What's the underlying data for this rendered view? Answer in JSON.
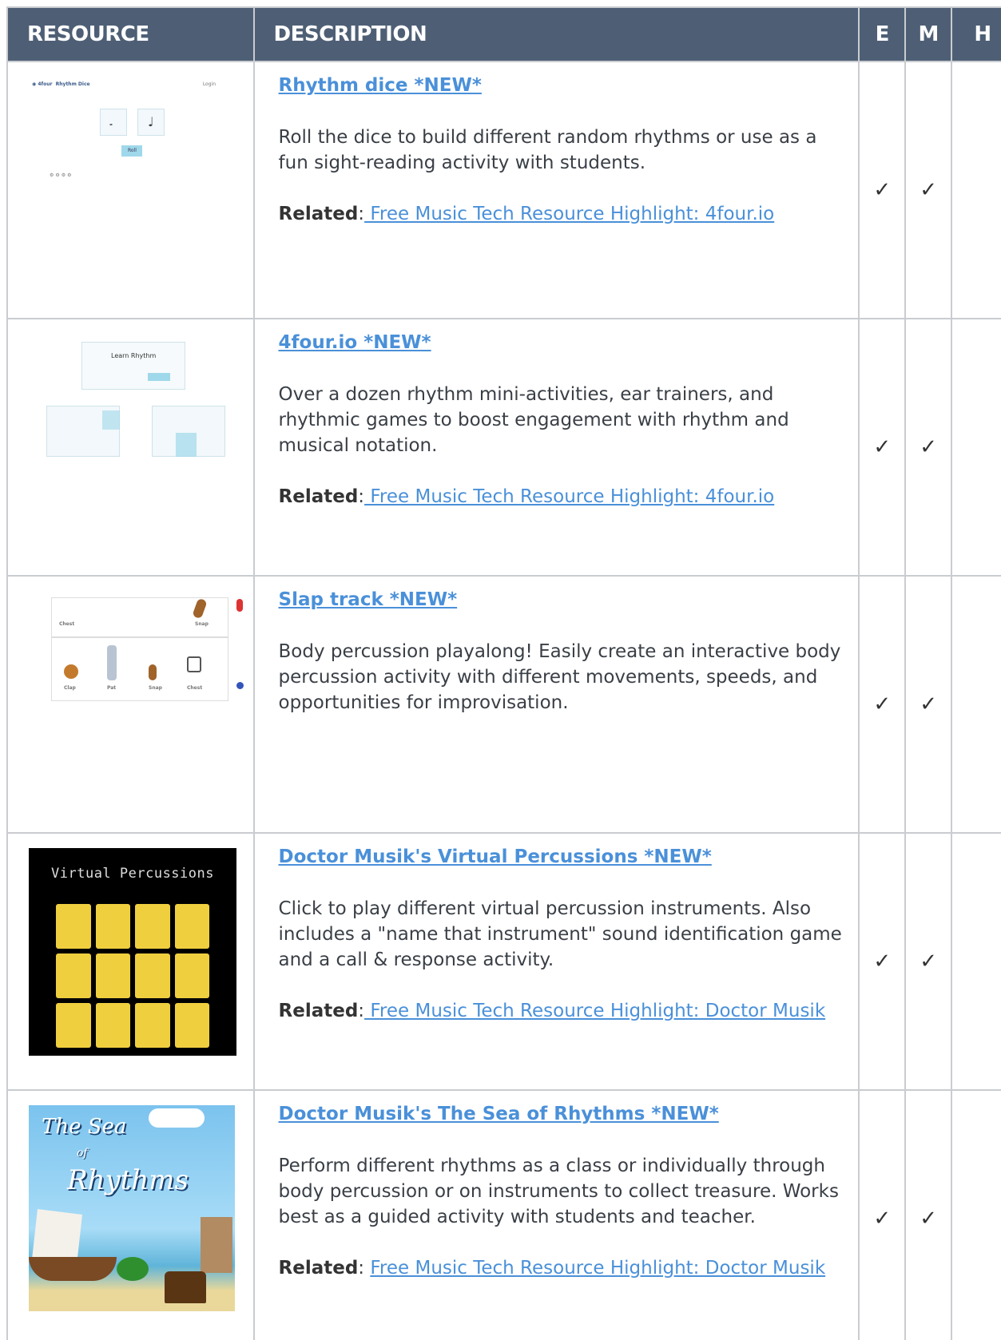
{
  "header": {
    "resource": "RESOURCE",
    "description": "DESCRIPTION",
    "e": "E",
    "m": "M",
    "h": "H"
  },
  "check": "✓",
  "rows": [
    {
      "title": "Rhythm dice *NEW*",
      "description": "Roll the dice to build different random rhythms or use as a fun sight-reading activity with students.",
      "related_label": "Related",
      "related_link": " Free Music Tech Resource Highlight: 4four.io",
      "thumb": {
        "app_name": "Rhythm Dice",
        "login": "Login",
        "roll": "Roll"
      }
    },
    {
      "title": "4four.io *NEW*",
      "description": "Over a dozen rhythm mini-activities, ear trainers, and rhythmic games to boost engagement with rhythm and musical notation.",
      "related_label": "Related",
      "related_link": " Free Music Tech Resource Highlight: 4four.io",
      "thumb": {
        "heading": "Learn Rhythm"
      }
    },
    {
      "title": "Slap track *NEW*",
      "description": "Body percussion playalong! Easily create an interactive body percussion activity with different movements, speeds, and opportunities for improvisation.",
      "thumb": {
        "labels": [
          "Chest",
          "Snap",
          "Clap",
          "Pat",
          "Snap",
          "Chest"
        ]
      }
    },
    {
      "title": "Doctor Musik's Virtual Percussions *NEW*",
      "description": "Click to play different virtual percussion instruments. Also includes a \"name that instrument\" sound identification game and a call & response activity.",
      "related_label": "Related",
      "related_link": " Free Music Tech Resource Highlight: Doctor Musik",
      "thumb": {
        "heading": "Virtual Percussions"
      }
    },
    {
      "title": "Doctor Musik's The Sea of Rhythms *NEW*",
      "description": "Perform different rhythms as a class or individually through body percussion or on instruments to collect treasure. Works best as a guided activity with students and teacher.",
      "related_label": "Related",
      "related_link": "Free Music Tech Resource Highlight: Doctor Musik",
      "thumb": {
        "line1": "The Sea",
        "line2": "of",
        "line3": "Rhythms"
      }
    }
  ]
}
